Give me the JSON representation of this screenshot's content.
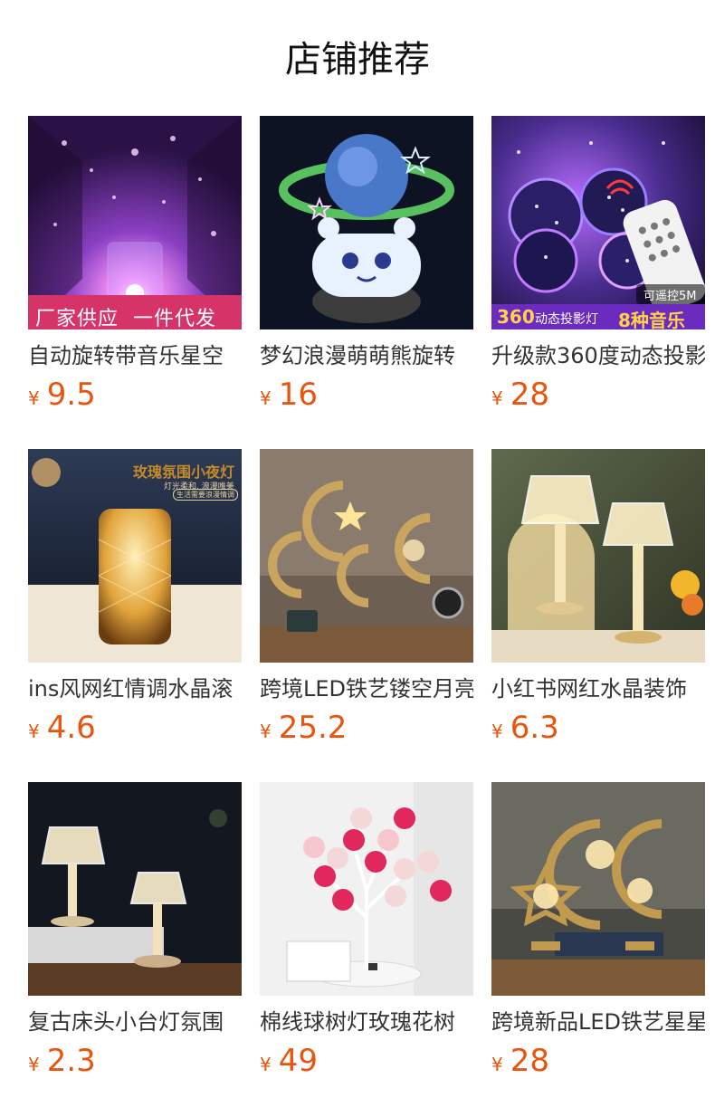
{
  "page": {
    "title": "店铺推荐"
  },
  "products": [
    {
      "name": "自动旋转带音乐星空",
      "currency": "¥",
      "price": "9.5",
      "badge": "厂家供应  一件代发",
      "theme": [
        "#3a1a5e",
        "#b05bd8",
        "#f3c3ff"
      ]
    },
    {
      "name": "梦幻浪漫萌萌熊旋转",
      "currency": "¥",
      "price": "16",
      "theme": [
        "#0c1222",
        "#2a4d7a",
        "#cfe6ff"
      ]
    },
    {
      "name": "升级款360度动态投影",
      "currency": "¥",
      "price": "28",
      "badge_top": "可遥控5M",
      "badge_left": "360",
      "badge_mid": "动态投影灯",
      "badge_right": "8种音乐",
      "theme": [
        "#1b0f3d",
        "#6b2fb0",
        "#ffd7ff"
      ]
    },
    {
      "name": "ins风网红情调水晶滚",
      "currency": "¥",
      "price": "4.6",
      "badge": "玫瑰氛围小夜灯",
      "badge_sub": "灯光柔和, 浪漫唯美",
      "badge_pill": "生活需要浪漫情调",
      "theme": [
        "#2d3a52",
        "#c58a2a",
        "#ffe7a8"
      ]
    },
    {
      "name": "跨境LED铁艺镂空月亮",
      "currency": "¥",
      "price": "25.2",
      "theme": [
        "#6b5a4a",
        "#c7a15c",
        "#f6e1b0"
      ]
    },
    {
      "name": "小红书网红水晶装饰",
      "currency": "¥",
      "price": "6.3",
      "theme": [
        "#6a6a4a",
        "#d7c58f",
        "#fff7d8"
      ]
    },
    {
      "name": "复古床头小台灯氛围",
      "currency": "¥",
      "price": "2.3",
      "theme": [
        "#141a22",
        "#b48b50",
        "#ffe5b8"
      ]
    },
    {
      "name": "棉线球树灯玫瑰花树",
      "currency": "¥",
      "price": "49",
      "theme": [
        "#efefef",
        "#d9336b",
        "#ffffff"
      ]
    },
    {
      "name": "跨境新品LED铁艺星星",
      "currency": "¥",
      "price": "28",
      "theme": [
        "#4a4a44",
        "#b88d3a",
        "#ffd98a"
      ]
    }
  ]
}
